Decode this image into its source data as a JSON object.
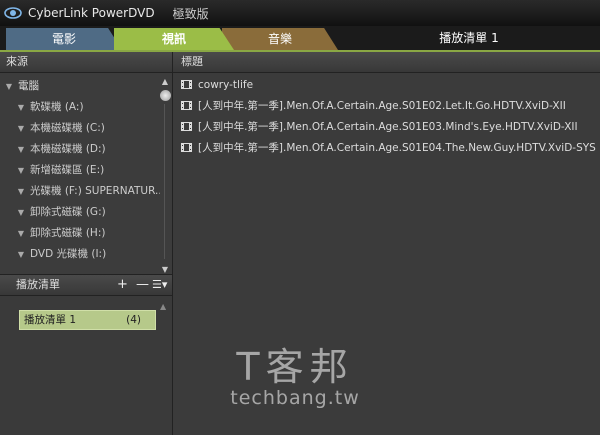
{
  "window": {
    "app_name": "CyberLink PowerDVD",
    "edition": "極致版"
  },
  "tabs": [
    {
      "label": "電影"
    },
    {
      "label": "視訊"
    },
    {
      "label": "音樂"
    }
  ],
  "playlist_title": "播放清單 1",
  "sources": {
    "header": "來源",
    "root": "電腦",
    "items": [
      {
        "label": "軟碟機 (A:)"
      },
      {
        "label": "本機磁碟機 (C:)"
      },
      {
        "label": "本機磁碟機 (D:)"
      },
      {
        "label": "新增磁碟區 (E:)"
      },
      {
        "label": "光碟機 (F:) SUPERNATUR..."
      },
      {
        "label": "卸除式磁碟 (G:)"
      },
      {
        "label": "卸除式磁碟 (H:)"
      },
      {
        "label": "DVD 光碟機 (I:)"
      }
    ]
  },
  "playlists": {
    "header": "播放清單",
    "add": "+",
    "remove": "—",
    "items": [
      {
        "name": "播放清單 1",
        "count": "(4)"
      }
    ]
  },
  "files": {
    "header": "標題",
    "items": [
      {
        "title": "cowry-tlife"
      },
      {
        "title": "[人到中年.第一季].Men.Of.A.Certain.Age.S01E02.Let.It.Go.HDTV.XviD-XII"
      },
      {
        "title": "[人到中年.第一季].Men.Of.A.Certain.Age.S01E03.Mind's.Eye.HDTV.XviD-XII"
      },
      {
        "title": "[人到中年.第一季].Men.Of.A.Certain.Age.S01E04.The.New.Guy.HDTV.XviD-SYS"
      }
    ]
  },
  "watermark": {
    "brand": "T客邦",
    "url": "techbang.tw"
  },
  "colors": {
    "video_tab": "#9bbd47",
    "movie_tab": "#4f6b85",
    "music_tab": "#8a6c3a",
    "playlist_selected": "#b6c98a"
  }
}
